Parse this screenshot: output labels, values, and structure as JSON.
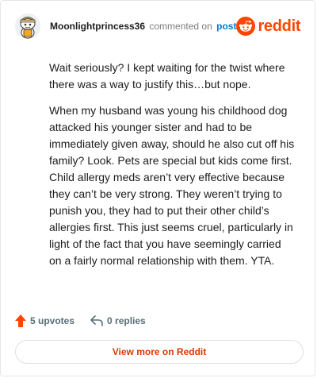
{
  "header": {
    "username": "Moonlightprincess36",
    "action_text": "commented on",
    "post_link": "post",
    "brand": "reddit",
    "avatar_icon": "snoo-avatar-icon",
    "brand_icon": "reddit-logo-icon"
  },
  "comment": {
    "paragraphs": [
      "Wait seriously? I kept waiting for the twist where there was a way to justify this…but nope.",
      "When my husband was young his childhood dog attacked his younger sister and had to be immediately given away, should he also cut off his family? Look. Pets are special but kids come first. Child allergy meds aren’t very effective because they can’t be very strong. They weren’t trying to punish you, they had to put their other child’s allergies first. This just seems cruel, particularly in light of the fact that you have seemingly carried on a fairly normal relationship with them. YTA."
    ]
  },
  "footer": {
    "upvotes_label": "5 upvotes",
    "replies_label": "0 replies",
    "upvote_icon": "upvote-arrow-icon",
    "reply_icon": "reply-icon"
  },
  "cta": {
    "label": "View more on Reddit"
  },
  "colors": {
    "brand": "#ff4500",
    "link": "#0079d3",
    "cta_text": "#d93a00",
    "muted": "#7c7c7c"
  }
}
